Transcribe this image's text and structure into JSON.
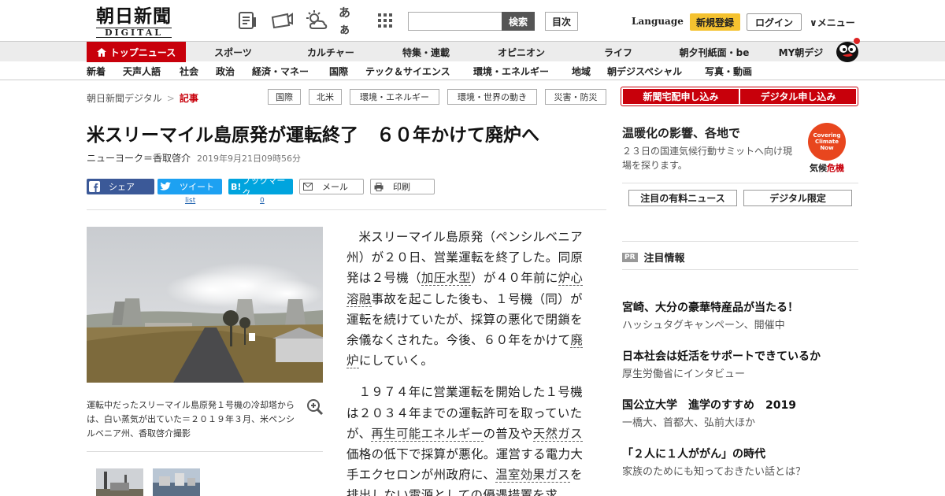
{
  "header": {
    "logo_main": "朝日新聞",
    "logo_sub": "DIGITAL",
    "search_button": "検索",
    "mokuji": "目次",
    "language": "Language",
    "signup": "新規登録",
    "login": "ログイン",
    "menu": "∨メニュー",
    "aa_icon_text": "あぁ"
  },
  "nav_main": [
    "トップニュース",
    "スポーツ",
    "カルチャー",
    "特集・連載",
    "オピニオン",
    "ライフ",
    "朝夕刊紙面・be",
    "MY朝デジ"
  ],
  "nav_sub": [
    "新着",
    "天声人語",
    "社会",
    "政治",
    "経済・マネー",
    "国際",
    "テック＆サイエンス",
    "環境・エネルギー",
    "地域",
    "朝デジスペシャル",
    "写真・動画"
  ],
  "breadcrumb": {
    "home": "朝日新聞デジタル",
    "sep": ">",
    "current": "記事"
  },
  "tags": [
    "国際",
    "北米",
    "環境・エネルギー",
    "環境・世界の動き",
    "災害・防災"
  ],
  "subscribe": {
    "newspaper": "新聞宅配申し込み",
    "digital": "デジタル申し込み"
  },
  "article": {
    "title": "米スリーマイル島原発が運転終了　６０年かけて廃炉へ",
    "author": "ニューヨーク＝香取啓介",
    "date": "2019年9月21日09時56分",
    "caption": "運転中だったスリーマイル島原発１号機の冷却塔からは、白い蒸気が出ていた＝２０１９年３月、米ペンシルベニア州、香取啓介撮影",
    "p1": [
      "米スリーマイル島原発（ペンシルベニア州）が２０日、営業運転を終了した。同原発は２号機（",
      "加圧水型",
      "）が４０年前に",
      "炉心溶融",
      "事故を起こした後も、１号機（同）が運転を続けていたが、採算の悪化で閉鎖を余儀なくされた。今後、６０年をかけて",
      "廃炉",
      "にしていく。"
    ],
    "p2": [
      "１９７４年に営業運転を開始した１号機は２０３４年までの運転許可を取っていたが、",
      "再生可能エネルギー",
      "の普及や",
      "天然ガス",
      "価格の低下で採算が悪化。運営する電力大手エクセロンが州政府に、",
      "温室効果ガス",
      "を排出しない電源としての優遇措置を求"
    ]
  },
  "share": {
    "facebook": "シェア",
    "twitter": "ツイート",
    "twitter_count": "list",
    "hatena": "ブックマーク",
    "hatena_icon": "B!",
    "hatena_count": "0",
    "mail": "メール",
    "print": "印刷"
  },
  "sidebar": {
    "feature_title": "温暖化の影響、各地で",
    "feature_sub": "２３日の国連気候行動サミットへ向け現場を探ります。",
    "badge_line": "Covering Climate Now",
    "badge_text_a": "気候",
    "badge_text_b": "危機",
    "btn_paid": "注目の有料ニュース",
    "btn_digital": "デジタル限定",
    "pr_tag": "PR",
    "pr_heading": "注目情報",
    "pr_items": [
      {
        "title": "宮崎、大分の豪華特産品が当たる！",
        "sub": "ハッシュタグキャンペーン、開催中"
      },
      {
        "title": "日本社会は妊活をサポートできているか",
        "sub": "厚生労働省にインタビュー"
      },
      {
        "title": "国公立大学　進学のすすめ　2019",
        "sub": "一橋大、首都大、弘前大ほか"
      },
      {
        "title": "「２人に１人ががん」の時代",
        "sub": "家族のためにも知っておきたい話とは？"
      }
    ]
  },
  "colors": {
    "brand_red": "#c8000b",
    "signup_yellow": "#f5c230",
    "facebook": "#3b5998",
    "twitter": "#1da1f2",
    "hatena": "#00a4de"
  }
}
